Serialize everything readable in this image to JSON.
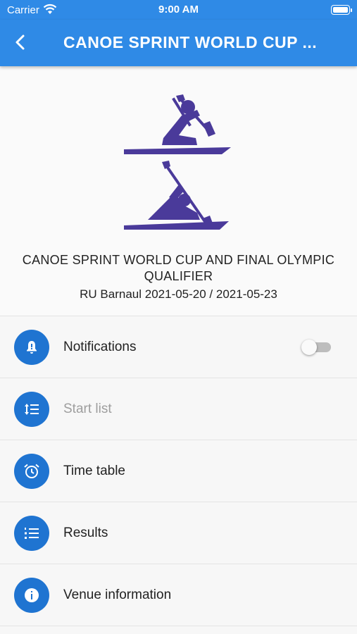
{
  "status_bar": {
    "carrier": "Carrier",
    "time": "9:00 AM"
  },
  "app_bar": {
    "title": "CANOE SPRINT WORLD CUP ..."
  },
  "event": {
    "title": "CANOE SPRINT WORLD CUP AND FINAL OLYMPIC QUALIFIER",
    "subtitle": "RU Barnaul 2021-05-20 / 2021-05-23"
  },
  "menu": [
    {
      "label": "Notifications",
      "icon": "bell-alert-icon",
      "toggle": false
    },
    {
      "label": "Start list",
      "icon": "format-line-spacing-icon",
      "disabled": true
    },
    {
      "label": "Time table",
      "icon": "alarm-clock-icon"
    },
    {
      "label": "Results",
      "icon": "numbered-list-icon"
    },
    {
      "label": "Venue information",
      "icon": "info-icon"
    }
  ],
  "colors": {
    "primary": "#2f8ae6",
    "icon_circle": "#1f74d1",
    "logo": "#4a3a9a"
  }
}
